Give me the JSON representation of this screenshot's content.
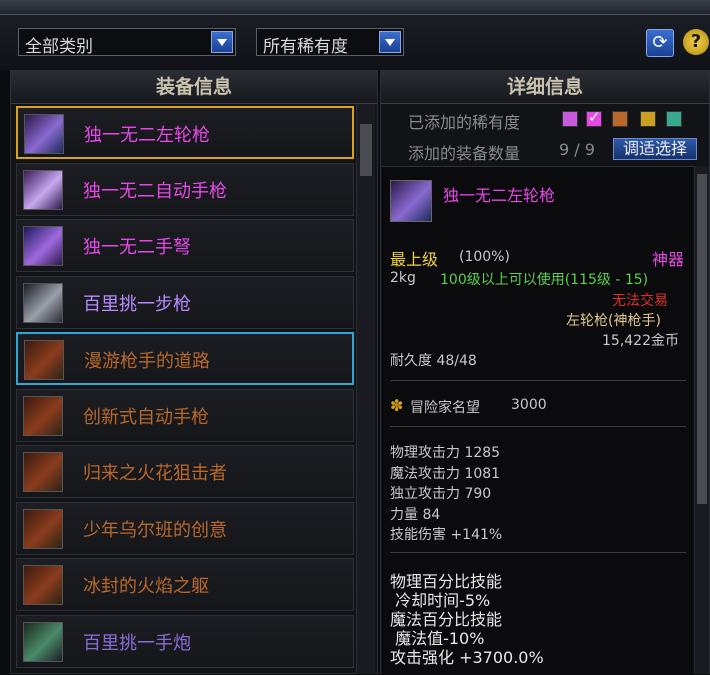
{
  "filters": {
    "category": "全部类别",
    "rarity": "所有稀有度"
  },
  "left_panel": {
    "title": "装备信息",
    "items": [
      {
        "name": "独一无二左轮枪",
        "color": "#e64ae6",
        "icon": "revolver-icon"
      },
      {
        "name": "独一无二自动手枪",
        "color": "#e64ae6",
        "icon": "auto-pistol-icon"
      },
      {
        "name": "独一无二手弩",
        "color": "#e64ae6",
        "icon": "crossbow-icon"
      },
      {
        "name": "百里挑一步枪",
        "color": "#b58cff",
        "icon": "rifle-icon"
      },
      {
        "name": "漫游枪手的道路",
        "color": "#b8682a",
        "icon": "chest-icon"
      },
      {
        "name": "创新式自动手枪",
        "color": "#b8682a",
        "icon": "chest-icon"
      },
      {
        "name": "归来之火花狙击者",
        "color": "#b8682a",
        "icon": "chest-icon"
      },
      {
        "name": "少年乌尔班的创意",
        "color": "#b8682a",
        "icon": "chest-icon"
      },
      {
        "name": "冰封的火焰之躯",
        "color": "#b8682a",
        "icon": "chest-icon"
      },
      {
        "name": "百里挑一手炮",
        "color": "#8a6cd6",
        "icon": "hand-cannon-icon"
      }
    ]
  },
  "right_panel": {
    "title": "详细信息",
    "rarity_label": "已添加的稀有度",
    "count_label": "添加的装备数量",
    "count_value": "9 / 9",
    "adjust_button": "调适选择",
    "rarity_colors": [
      "#c85ae0",
      "#e64ae6",
      "#b8682a",
      "#c9a020",
      "#3aa890"
    ],
    "detail": {
      "item_name": "独一无二左轮枪",
      "grade": "最上级",
      "grade_pct": "(100%)",
      "rarity": "神器",
      "weight": "2kg",
      "level_req": "100级以上可以使用(115级 - 15)",
      "trade": "无法交易",
      "type": "左轮枪(神枪手)",
      "price": "15,422金币",
      "durability": "耐久度 48/48",
      "fame_label": "冒险家名望",
      "fame_value": "3000",
      "stats": [
        "物理攻击力 1285",
        "魔法攻击力 1081",
        "独立攻击力 790",
        "力量 84",
        "技能伤害 +141%"
      ],
      "skills": [
        "物理百分比技能",
        " 冷却时间-5%",
        "魔法百分比技能",
        " 魔法值-10%",
        "攻击强化 +3700.0%"
      ]
    }
  }
}
